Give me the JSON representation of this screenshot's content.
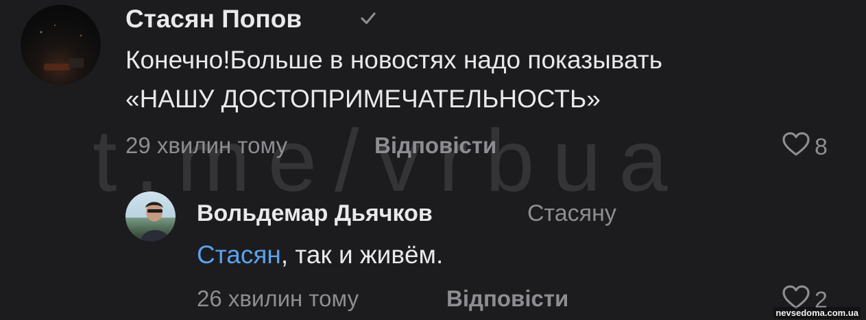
{
  "comment": {
    "author": "Стасян Попов",
    "verified_icon": "checkmark-icon",
    "text_line1": "Конечно!Больше в новостях надо показывать",
    "text_line2": "«НАШУ ДОСТОПРИМЕЧАТЕЛЬНОСТЬ»",
    "time": "29 хвилин тому",
    "reply_label": "Відповісти",
    "like_icon": "heart-outline-icon",
    "likes": "8"
  },
  "reply": {
    "author": "Вольдемар Дьячков",
    "reply_to": "Стасяну",
    "mention": "Стасян",
    "text_rest": ", так и живём.",
    "time": "26 хвилин тому",
    "reply_label": "Відповісти",
    "like_icon": "heart-outline-icon",
    "likes": "2"
  },
  "overlays": {
    "watermark": "t.me/vrbua",
    "site_watermark": "nevsedoma.com.ua"
  },
  "colors": {
    "background": "#1c1c1e",
    "text": "#e9e9eb",
    "secondary": "#8d8d92",
    "mention": "#5aa2f0"
  }
}
